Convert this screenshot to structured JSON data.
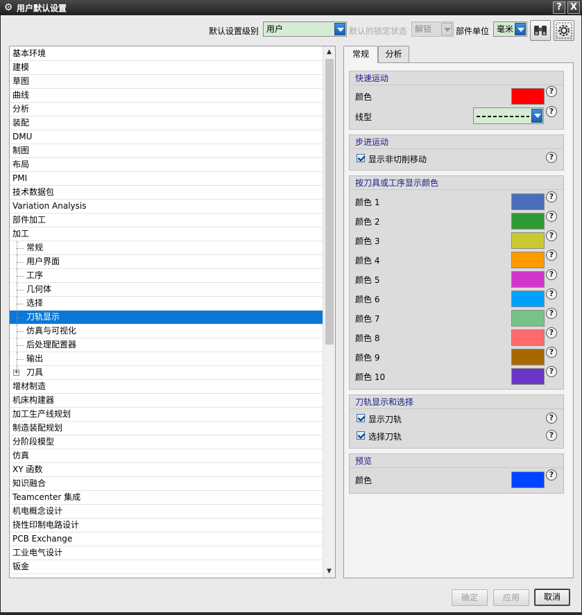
{
  "window": {
    "title": "用户默认设置",
    "help_btn": "?",
    "close_btn": "X"
  },
  "toolbar": {
    "level_label": "默认设置级别",
    "level_value": "用户",
    "lock_label": "默认的锁定状态",
    "lock_value": "解锁",
    "unit_label": "部件单位",
    "unit_value": "毫米"
  },
  "tree": [
    "基本环境",
    "建模",
    "草图",
    "曲线",
    "分析",
    "装配",
    "DMU",
    "制图",
    "布局",
    "PMI",
    "技术数据包",
    "Variation Analysis",
    "部件加工",
    "加工",
    "常规",
    "用户界面",
    "工序",
    "几何体",
    "选择",
    "刀轨显示",
    "仿真与可视化",
    "后处理配置器",
    "输出",
    "刀具",
    "增材制造",
    "机床构建器",
    "加工生产线规划",
    "制造装配规划",
    "分阶段模型",
    "仿真",
    "XY 函数",
    "知识融合",
    "Teamcenter 集成",
    "机电概念设计",
    "挠性印制电路设计",
    "PCB Exchange",
    "工业电气设计",
    "钣金"
  ],
  "tabs": [
    "常规",
    "分析"
  ],
  "groups": {
    "rapid": {
      "title": "快速运动",
      "color_label": "颜色",
      "color": "#ff0000",
      "linetype_label": "线型"
    },
    "step": {
      "title": "步进运动",
      "show_noncut": "显示非切削移动"
    },
    "tool_colors": {
      "title": "按刀具或工序显示颜色",
      "items": [
        {
          "label": "颜色 1",
          "color": "#4a6fba"
        },
        {
          "label": "颜色 2",
          "color": "#2f9a35"
        },
        {
          "label": "颜色 3",
          "color": "#c9c934"
        },
        {
          "label": "颜色 4",
          "color": "#ff9a00"
        },
        {
          "label": "颜色 5",
          "color": "#d235c9"
        },
        {
          "label": "颜色 6",
          "color": "#00a0ff"
        },
        {
          "label": "颜色 7",
          "color": "#79c286"
        },
        {
          "label": "颜色 8",
          "color": "#ff6b6b"
        },
        {
          "label": "颜色 9",
          "color": "#a86800"
        },
        {
          "label": "颜色 10",
          "color": "#6a35c9"
        }
      ]
    },
    "display": {
      "title": "刀轨显示和选择",
      "show_path": "显示刀轨",
      "select_path": "选择刀轨"
    },
    "preview": {
      "title": "预览",
      "color_label": "颜色",
      "color": "#0044ff"
    }
  },
  "buttons": {
    "ok": "确定",
    "apply": "应用",
    "cancel": "取消"
  },
  "selected_tree_item": "刀轨显示"
}
